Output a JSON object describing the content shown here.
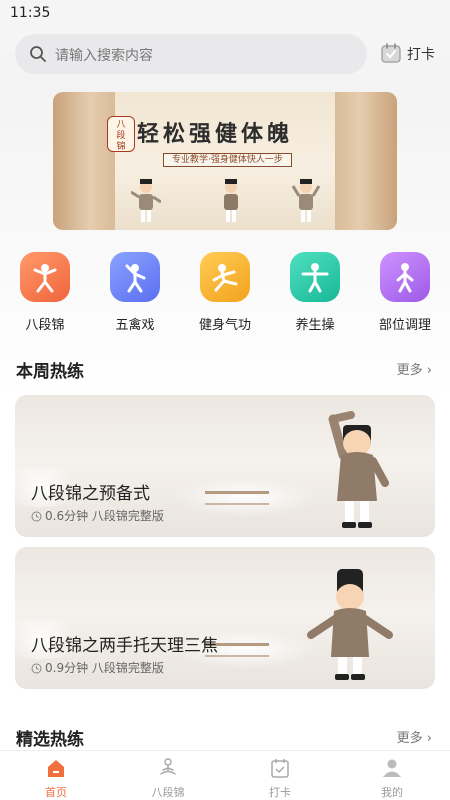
{
  "status_bar": {
    "time": "11:35"
  },
  "search": {
    "placeholder": "请输入搜索内容"
  },
  "checkin": {
    "label": "打卡"
  },
  "banner": {
    "badge": "八段锦",
    "title": "轻松强健体魄",
    "subtitle": "专业教学·强身健体快人一步"
  },
  "categories": [
    {
      "label": "八段锦",
      "icon": "baduanjin-figure-icon",
      "color": "#f5744a"
    },
    {
      "label": "五禽戏",
      "icon": "wuqinxi-figure-icon",
      "color": "#6f86f5"
    },
    {
      "label": "健身气功",
      "icon": "qigong-figure-icon",
      "color": "#f7b52f"
    },
    {
      "label": "养生操",
      "icon": "exercise-figure-icon",
      "color": "#2ec9a8"
    },
    {
      "label": "部位调理",
      "icon": "body-care-figure-icon",
      "color": "#b374f0"
    }
  ],
  "weekly": {
    "title": "本周热练",
    "more": "更多",
    "items": [
      {
        "title": "八段锦之预备式",
        "meta": "0.6分钟  八段锦完整版"
      },
      {
        "title": "八段锦之两手托天理三焦",
        "meta": "0.9分钟  八段锦完整版"
      }
    ]
  },
  "featured": {
    "title": "精选热练",
    "more": "更多"
  },
  "tabs": [
    {
      "label": "首页",
      "icon": "home-icon",
      "active": true
    },
    {
      "label": "八段锦",
      "icon": "meditation-icon",
      "active": false
    },
    {
      "label": "打卡",
      "icon": "calendar-check-icon",
      "active": false
    },
    {
      "label": "我的",
      "icon": "user-icon",
      "active": false
    }
  ],
  "colors": {
    "accent": "#f07040"
  }
}
